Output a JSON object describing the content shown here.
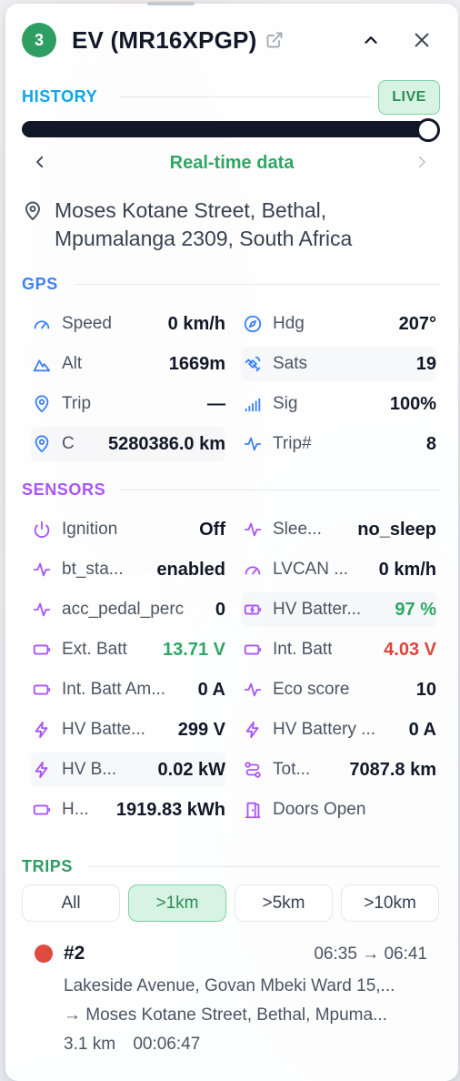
{
  "header": {
    "number": "3",
    "title": "EV (MR16XPGP)"
  },
  "history": {
    "label": "HISTORY",
    "live_label": "LIVE",
    "slider_position_fraction": 1.0,
    "mode_label": "Real-time data"
  },
  "address": "Moses Kotane Street, Bethal, Mpumalanga 2309, South Africa",
  "gps": {
    "label": "GPS",
    "rows": [
      {
        "left": {
          "icon": "speedometer-icon",
          "label": "Speed",
          "value": "0 km/h"
        },
        "right": {
          "icon": "compass-icon",
          "label": "Hdg",
          "value": "207°"
        }
      },
      {
        "left": {
          "icon": "mountain-icon",
          "label": "Alt",
          "value": "1669m"
        },
        "right": {
          "icon": "satellite-icon",
          "label": "Sats",
          "value": "19"
        }
      },
      {
        "left": {
          "icon": "map-pin-icon",
          "label": "Trip",
          "value": "—"
        },
        "right": {
          "icon": "signal-icon",
          "label": "Sig",
          "value": "100%"
        }
      },
      {
        "left": {
          "icon": "map-pin-icon",
          "label": "C",
          "value": "5280386.0 km"
        },
        "right": {
          "icon": "activity-icon",
          "label": "Trip#",
          "value": "8"
        }
      }
    ]
  },
  "sensors": {
    "label": "SENSORS",
    "rows": [
      {
        "left": {
          "icon": "power-icon",
          "label": "Ignition",
          "value": "Off"
        },
        "right": {
          "icon": "activity-icon",
          "label": "Slee...",
          "value": "no_sleep"
        }
      },
      {
        "left": {
          "icon": "activity-icon",
          "label": "bt_sta...",
          "value": "enabled"
        },
        "right": {
          "icon": "speedometer-icon",
          "label": "LVCAN ...",
          "value": "0 km/h"
        }
      },
      {
        "left": {
          "icon": "activity-icon",
          "label": "acc_pedal_perc",
          "value": "0"
        },
        "right": {
          "icon": "battery-charging-icon",
          "label": "HV Batter...",
          "value": "97 %",
          "value_color": "#2ea763"
        }
      },
      {
        "left": {
          "icon": "battery-icon",
          "label": "Ext. Batt",
          "value": "13.71 V",
          "value_color": "#2ea763"
        },
        "right": {
          "icon": "battery-icon",
          "label": "Int. Batt",
          "value": "4.03 V",
          "value_color": "#e0443a"
        }
      },
      {
        "left": {
          "icon": "battery-icon",
          "label": "Int. Batt Am...",
          "value": "0 A"
        },
        "right": {
          "icon": "activity-icon",
          "label": "Eco score",
          "value": "10"
        }
      },
      {
        "left": {
          "icon": "lightning-icon",
          "label": "HV Batte...",
          "value": "299 V"
        },
        "right": {
          "icon": "lightning-icon",
          "label": "HV Battery ...",
          "value": "0 A"
        }
      },
      {
        "left": {
          "icon": "lightning-icon",
          "label": "HV B...",
          "value": "0.02 kW"
        },
        "right": {
          "icon": "route-icon",
          "label": "Tot...",
          "value": "7087.8 km"
        }
      },
      {
        "left": {
          "icon": "battery-icon",
          "label": "H...",
          "value": "1919.83 kWh"
        },
        "right": {
          "icon": "door-icon",
          "label": "Doors Open",
          "value": ""
        }
      }
    ]
  },
  "trips": {
    "label": "TRIPS",
    "tabs": [
      "All",
      ">1km",
      ">5km",
      ">10km"
    ],
    "active_tab": 1,
    "items": [
      {
        "id": "#2",
        "time": "06:35 → 06:41",
        "from": "Lakeside Avenue, Govan Mbeki Ward 15,...",
        "to": "→  Moses Kotane Street, Bethal, Mpuma...",
        "distance": "3.1 km",
        "duration": "00:06:47"
      }
    ]
  },
  "colors": {
    "accent_green": "#2ea763",
    "gps_blue": "#3b82f6",
    "sensor_purple": "#a855f7",
    "trips_green": "#2e9e63",
    "alert_red": "#e0443a"
  }
}
